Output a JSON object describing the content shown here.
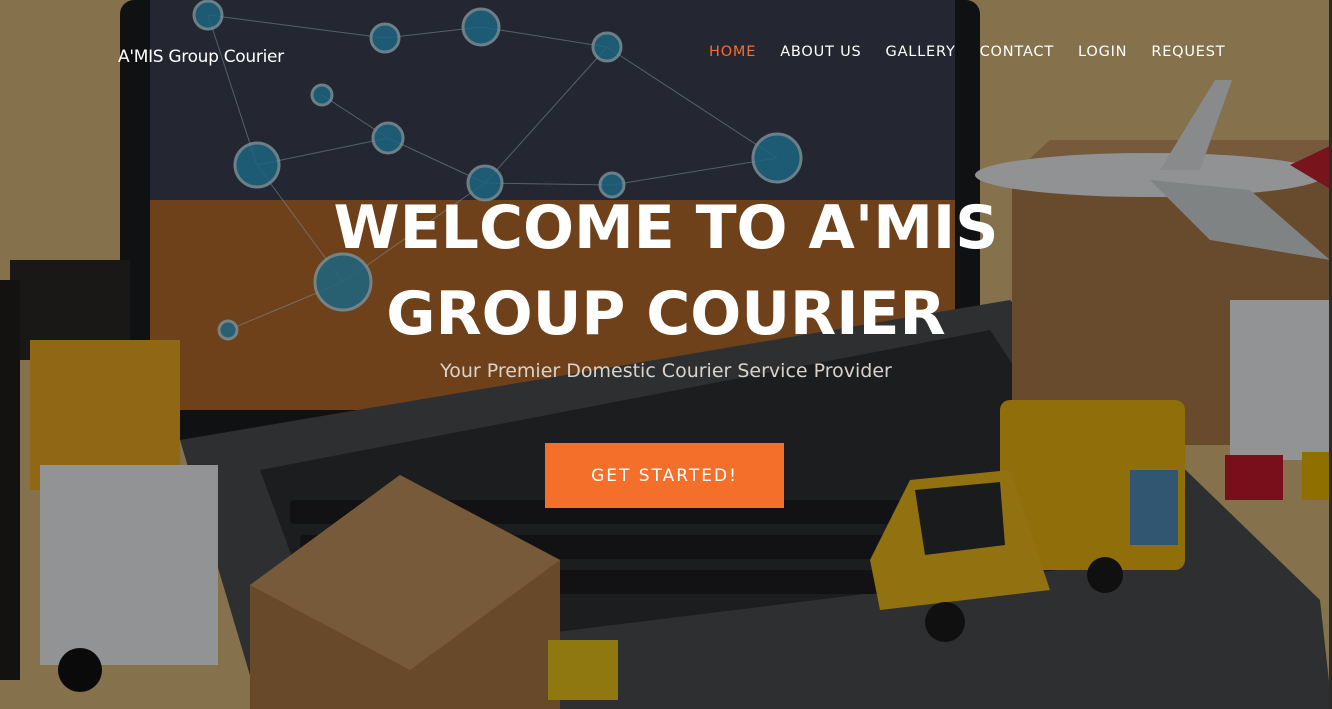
{
  "brand": {
    "name": "A'MIS Group Courier"
  },
  "nav": {
    "items": [
      {
        "label": "HOME",
        "active": true
      },
      {
        "label": "ABOUT US",
        "active": false
      },
      {
        "label": "GALLERY",
        "active": false
      },
      {
        "label": "CONTACT",
        "active": false
      },
      {
        "label": "LOGIN",
        "active": false
      },
      {
        "label": "REQUEST",
        "active": false
      }
    ]
  },
  "hero": {
    "title_line1": "WELCOME TO A'MIS",
    "title_line2": "GROUP COURIER",
    "subtitle": "Your Premier Domestic Courier Service Provider",
    "cta_label": "GET STARTED!"
  },
  "colors": {
    "accent": "#f36f2a",
    "text": "#ffffff"
  }
}
